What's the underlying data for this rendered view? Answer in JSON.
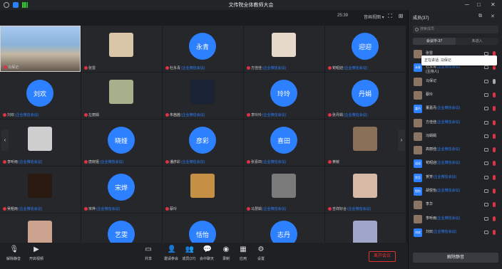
{
  "window": {
    "title": "文传院全体教师大会"
  },
  "topbar": {
    "time": "25:39",
    "speaker_view": "音画视图 ▾"
  },
  "grid": {
    "tiles": [
      {
        "name": "马保记",
        "kind": "video",
        "active": true
      },
      {
        "name": "张雷",
        "kind": "pic",
        "pic": "#d9c6a8"
      },
      {
        "name": "杜永青",
        "note": "(企业微信会议)",
        "kind": "circle",
        "initials": "永青"
      },
      {
        "name": "方佳佳",
        "note": "(企业微信会议)",
        "kind": "pic",
        "pic": "#e7d9c9"
      },
      {
        "name": "荀昭迎",
        "note": "(企业微信会议)",
        "kind": "circle",
        "initials": "迎迎"
      },
      {
        "name": "刘欢",
        "note": "(企业微信会议)",
        "kind": "circle",
        "initials": "刘欢"
      },
      {
        "name": "左丽娟",
        "kind": "pic",
        "pic": "#a7b08a"
      },
      {
        "name": "朱茜茜",
        "note": "(企业微信会议)",
        "kind": "pic",
        "pic": "#1a2335"
      },
      {
        "name": "李玲玲",
        "note": "(企业微信会议)",
        "kind": "circle",
        "initials": "玲玲"
      },
      {
        "name": "张丹娟",
        "note": "(企业微信会议)",
        "kind": "circle",
        "initials": "丹娟"
      },
      {
        "name": "李听雨",
        "note": "(企业微信会议)",
        "kind": "pic",
        "pic": "#cfcfcf"
      },
      {
        "name": "唐晓娅",
        "note": "(企业微信会议)",
        "kind": "circle",
        "initials": "晓娅"
      },
      {
        "name": "潘彦彩",
        "note": "(企业微信会议)",
        "kind": "circle",
        "initials": "彦彩"
      },
      {
        "name": "张喜田",
        "note": "(企业微信会议)",
        "kind": "circle",
        "initials": "喜田"
      },
      {
        "name": "黄敏",
        "kind": "pic",
        "pic": "#8a7059"
      },
      {
        "name": "吴粗雨",
        "note": "(企业微信会议)",
        "kind": "pic",
        "pic": "#2b1a10"
      },
      {
        "name": "宋烨",
        "note": "(企业微信会议)",
        "kind": "circle",
        "initials": "宋烨"
      },
      {
        "name": "蔡玲",
        "kind": "pic",
        "pic": "#c59045"
      },
      {
        "name": "马慧娟",
        "note": "(企业微信会议)",
        "kind": "pic",
        "pic": "#7a7a7a"
      },
      {
        "name": "吉祥好合",
        "note": "(企业微信会议)",
        "kind": "pic",
        "pic": "#d7b9a5"
      },
      {
        "name": "",
        "kind": "pic",
        "pic": "#cba38e"
      },
      {
        "name": "",
        "kind": "circle",
        "initials": "艺雯"
      },
      {
        "name": "",
        "kind": "circle",
        "initials": "恬怡"
      },
      {
        "name": "",
        "kind": "circle",
        "initials": "志丹"
      },
      {
        "name": "",
        "kind": "pic",
        "pic": "#9fa6c9"
      }
    ]
  },
  "panel": {
    "title": "成员(37)",
    "search_placeholder": "搜索成员",
    "tab_in": "会议中·37",
    "tab_out": "未进入",
    "tooltip": "正在讲话: 马保记",
    "unmute_all": "解除静音",
    "members": [
      {
        "name": "张雷",
        "note": "",
        "av": "img",
        "initials": "",
        "mic": "off"
      },
      {
        "name": "杜永青",
        "note": "(企业微信会议)",
        "sub": "(主持人)",
        "av": "blue",
        "initials": "永青",
        "mic": "off"
      },
      {
        "name": "马保记",
        "note": "",
        "av": "img",
        "initials": "",
        "mic": "ok"
      },
      {
        "name": "蔡玲",
        "note": "",
        "av": "img",
        "initials": "",
        "mic": "off"
      },
      {
        "name": "董嘉丹",
        "note": "(企业微信会议)",
        "av": "blue",
        "initials": "嘉丹",
        "mic": "off"
      },
      {
        "name": "方佳佳",
        "note": "(企业微信会议)",
        "av": "img",
        "initials": "",
        "mic": "off"
      },
      {
        "name": "冯娟娟",
        "note": "",
        "av": "img",
        "initials": "",
        "mic": "off"
      },
      {
        "name": "高丽佳",
        "note": "(企业微信会议)",
        "av": "img",
        "initials": "",
        "mic": "off"
      },
      {
        "name": "荀昭迎",
        "note": "(企业微信会议)",
        "av": "blue",
        "initials": "迎迎",
        "mic": "off"
      },
      {
        "name": "贺芳",
        "note": "(企业微信会议)",
        "av": "blue",
        "initials": "贺芳",
        "mic": "off"
      },
      {
        "name": "胡悦怡",
        "note": "(企业微信会议)",
        "av": "blue",
        "initials": "悦怡",
        "mic": "off"
      },
      {
        "name": "李华",
        "note": "",
        "av": "img",
        "initials": "",
        "mic": "off"
      },
      {
        "name": "李听雨",
        "note": "(企业微信会议)",
        "av": "img",
        "initials": "",
        "mic": "off"
      },
      {
        "name": "刘欢",
        "note": "(企业微信会议)",
        "av": "blue",
        "initials": "刘欢",
        "mic": "off"
      }
    ]
  },
  "bottombar": {
    "mute": "解除静音",
    "video": "开启视频",
    "share": "共享",
    "invite": "邀请参会",
    "members": "成员(37)",
    "chat": "会中聊天",
    "record": "录制",
    "apps": "应用",
    "settings": "设置",
    "leave": "离开会议"
  }
}
